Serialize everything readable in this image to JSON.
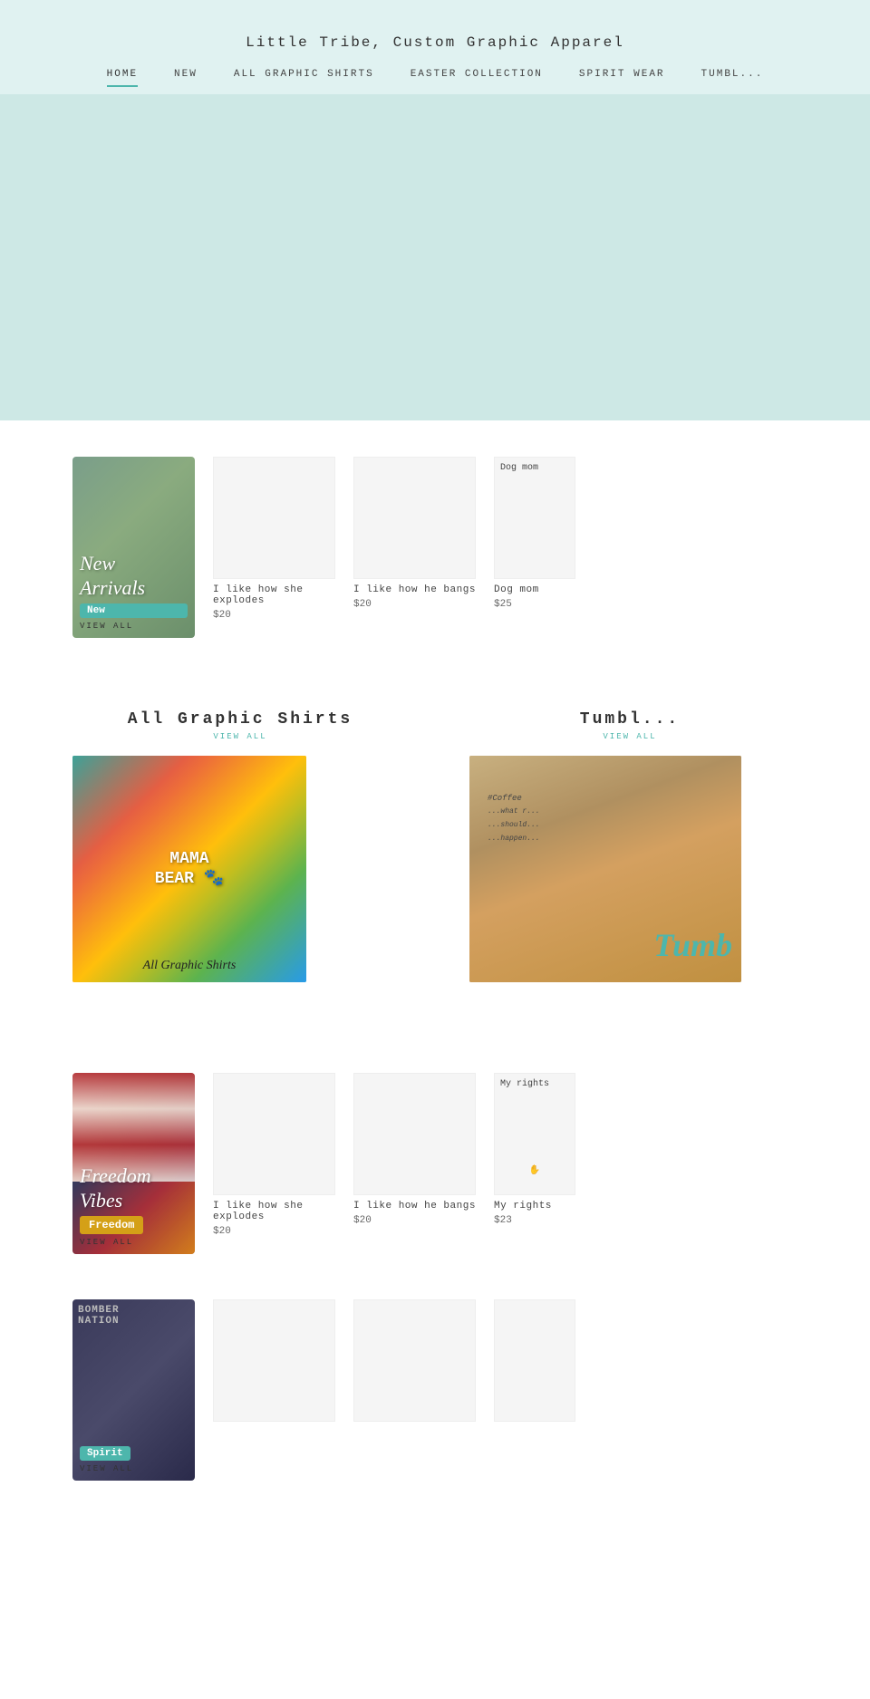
{
  "site": {
    "title": "Little Tribe, Custom Graphic Apparel"
  },
  "nav": {
    "items": [
      {
        "label": "HOME",
        "active": true
      },
      {
        "label": "NEW",
        "active": false
      },
      {
        "label": "ALL GRAPHIC SHIRTS",
        "active": false
      },
      {
        "label": "EASTER COLLECTION",
        "active": false
      },
      {
        "label": "SPIRIT WEAR",
        "active": false
      },
      {
        "label": "TUMBL...",
        "active": false
      }
    ]
  },
  "new_arrivals": {
    "card_script_line1": "New",
    "card_script_line2": "Arrivals",
    "card_badge": "New",
    "card_view_all": "VIEW ALL",
    "products": [
      {
        "name": "I like how she explodes",
        "price": "$20"
      },
      {
        "name": "I like how he bangs",
        "price": "$20"
      },
      {
        "name": "Dog mom",
        "price": "$25"
      }
    ]
  },
  "all_graphic": {
    "heading": "All Graphic Shirts",
    "view_all": "VIEW ALL",
    "image_text": "All Graphic Shirts",
    "mama_bear": "MAMA\nBEAR"
  },
  "tumblers": {
    "heading": "Tumbl...",
    "view_all": "VIEW ALL",
    "image_text": "Tumb"
  },
  "freedom": {
    "card_text1": "Freedom",
    "card_badge": "Freedom",
    "card_view_all": "VIEW ALL",
    "products": [
      {
        "name": "I like how she explodes",
        "price": "$20"
      },
      {
        "name": "I like how he bangs",
        "price": "$20"
      },
      {
        "name": "My rights",
        "price": "$23"
      }
    ]
  },
  "spirit": {
    "card_text": "Spirit",
    "card_badge": "Spirit",
    "card_view_all": "VIEW ALL"
  }
}
